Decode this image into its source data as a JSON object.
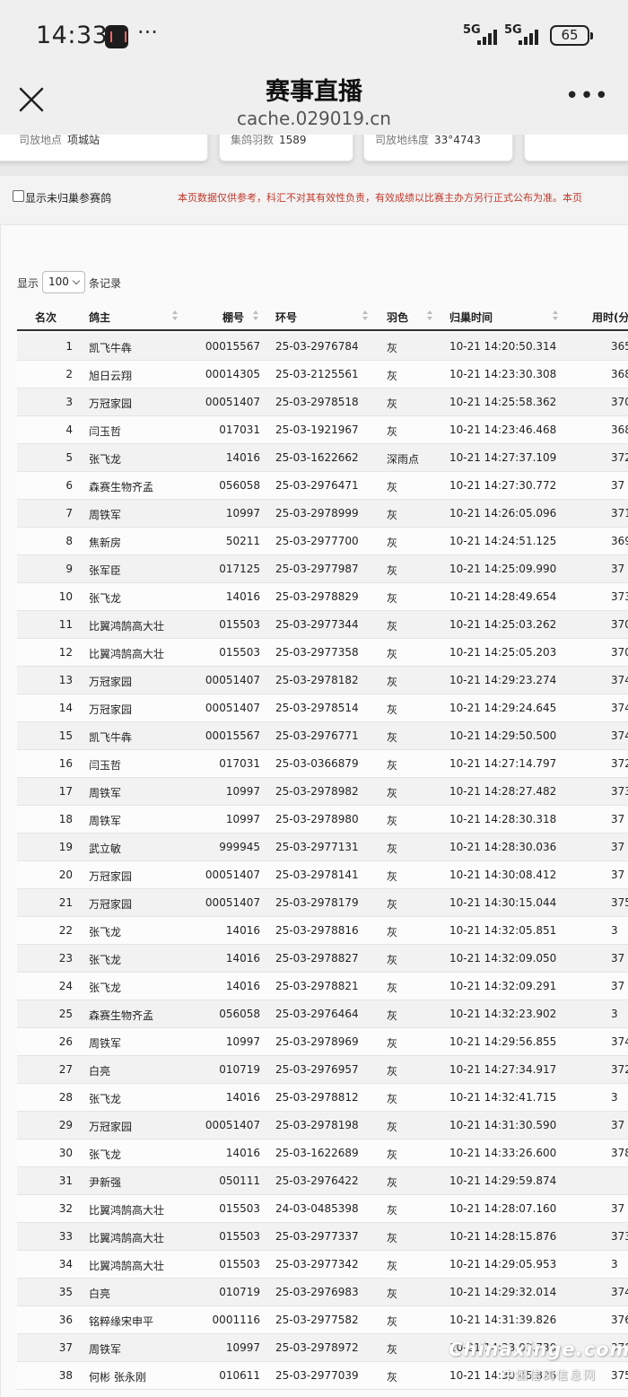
{
  "status_bar": {
    "time": "14:33",
    "network_1": "5G",
    "network_2": "5G",
    "battery": "65"
  },
  "nav": {
    "title": "赛事直播",
    "url": "cache.029019.cn"
  },
  "info_cards": [
    {
      "label": "司放地点",
      "value": "项城站"
    },
    {
      "label": "集鸽羽数",
      "value": "1589"
    },
    {
      "label": "司放地纬度",
      "value": "33°4743"
    },
    {
      "label": "",
      "value": ""
    }
  ],
  "filters": {
    "show_unreturned_label": "显示未归巢参赛鸽",
    "disclaimer": "本页数据仅供参考，科汇不对其有效性负责，有效成绩以比赛主办方另行正式公布为准。本页"
  },
  "length_control": {
    "prefix": "显示",
    "selected": "100",
    "suffix": "条记录"
  },
  "table": {
    "headers": {
      "rank": "名次",
      "owner": "鸽主",
      "loft": "棚号",
      "ring": "环号",
      "color": "羽色",
      "return_time": "归巢时间",
      "time_used": "用时(分"
    },
    "rows": [
      {
        "rank": "1",
        "owner": "凯飞牛犇",
        "loft": "00015567",
        "ring": "25-03-2976784",
        "color": "灰",
        "time": "10-21 14:20:50.314",
        "used": "365"
      },
      {
        "rank": "2",
        "owner": "旭日云翔",
        "loft": "00014305",
        "ring": "25-03-2125561",
        "color": "灰",
        "time": "10-21 14:23:30.308",
        "used": "368"
      },
      {
        "rank": "3",
        "owner": "万冠家园",
        "loft": "00051407",
        "ring": "25-03-2978518",
        "color": "灰",
        "time": "10-21 14:25:58.362",
        "used": "370"
      },
      {
        "rank": "4",
        "owner": "闫玉哲",
        "loft": "017031",
        "ring": "25-03-1921967",
        "color": "灰",
        "time": "10-21 14:23:46.468",
        "used": "368"
      },
      {
        "rank": "5",
        "owner": "张飞龙",
        "loft": "14016",
        "ring": "25-03-1622662",
        "color": "深雨点",
        "time": "10-21 14:27:37.109",
        "used": "372"
      },
      {
        "rank": "6",
        "owner": "森赛生物齐孟",
        "loft": "056058",
        "ring": "25-03-2976471",
        "color": "灰",
        "time": "10-21 14:27:30.772",
        "used": "37"
      },
      {
        "rank": "7",
        "owner": "周铁军",
        "loft": "10997",
        "ring": "25-03-2978999",
        "color": "灰",
        "time": "10-21 14:26:05.096",
        "used": "371"
      },
      {
        "rank": "8",
        "owner": "焦新房",
        "loft": "50211",
        "ring": "25-03-2977700",
        "color": "灰",
        "time": "10-21 14:24:51.125",
        "used": "369"
      },
      {
        "rank": "9",
        "owner": "张军臣",
        "loft": "017125",
        "ring": "25-03-2977987",
        "color": "灰",
        "time": "10-21 14:25:09.990",
        "used": "37"
      },
      {
        "rank": "10",
        "owner": "张飞龙",
        "loft": "14016",
        "ring": "25-03-2978829",
        "color": "灰",
        "time": "10-21 14:28:49.654",
        "used": "373"
      },
      {
        "rank": "11",
        "owner": "比翼鸿鹄高大壮",
        "loft": "015503",
        "ring": "25-03-2977344",
        "color": "灰",
        "time": "10-21 14:25:03.262",
        "used": "370"
      },
      {
        "rank": "12",
        "owner": "比翼鸿鹄高大壮",
        "loft": "015503",
        "ring": "25-03-2977358",
        "color": "灰",
        "time": "10-21 14:25:05.203",
        "used": "370"
      },
      {
        "rank": "13",
        "owner": "万冠家园",
        "loft": "00051407",
        "ring": "25-03-2978182",
        "color": "灰",
        "time": "10-21 14:29:23.274",
        "used": "374"
      },
      {
        "rank": "14",
        "owner": "万冠家园",
        "loft": "00051407",
        "ring": "25-03-2978514",
        "color": "灰",
        "time": "10-21 14:29:24.645",
        "used": "374"
      },
      {
        "rank": "15",
        "owner": "凯飞牛犇",
        "loft": "00015567",
        "ring": "25-03-2976771",
        "color": "灰",
        "time": "10-21 14:29:50.500",
        "used": "374"
      },
      {
        "rank": "16",
        "owner": "闫玉哲",
        "loft": "017031",
        "ring": "25-03-0366879",
        "color": "灰",
        "time": "10-21 14:27:14.797",
        "used": "372"
      },
      {
        "rank": "17",
        "owner": "周铁军",
        "loft": "10997",
        "ring": "25-03-2978982",
        "color": "灰",
        "time": "10-21 14:28:27.482",
        "used": "373"
      },
      {
        "rank": "18",
        "owner": "周铁军",
        "loft": "10997",
        "ring": "25-03-2978980",
        "color": "灰",
        "time": "10-21 14:28:30.318",
        "used": "37"
      },
      {
        "rank": "19",
        "owner": "武立敏",
        "loft": "999945",
        "ring": "25-03-2977131",
        "color": "灰",
        "time": "10-21 14:28:30.036",
        "used": "37"
      },
      {
        "rank": "20",
        "owner": "万冠家园",
        "loft": "00051407",
        "ring": "25-03-2978141",
        "color": "灰",
        "time": "10-21 14:30:08.412",
        "used": "37"
      },
      {
        "rank": "21",
        "owner": "万冠家园",
        "loft": "00051407",
        "ring": "25-03-2978179",
        "color": "灰",
        "time": "10-21 14:30:15.044",
        "used": "375"
      },
      {
        "rank": "22",
        "owner": "张飞龙",
        "loft": "14016",
        "ring": "25-03-2978816",
        "color": "灰",
        "time": "10-21 14:32:05.851",
        "used": "3"
      },
      {
        "rank": "23",
        "owner": "张飞龙",
        "loft": "14016",
        "ring": "25-03-2978827",
        "color": "灰",
        "time": "10-21 14:32:09.050",
        "used": "37"
      },
      {
        "rank": "24",
        "owner": "张飞龙",
        "loft": "14016",
        "ring": "25-03-2978821",
        "color": "灰",
        "time": "10-21 14:32:09.291",
        "used": "37"
      },
      {
        "rank": "25",
        "owner": "森赛生物齐孟",
        "loft": "056058",
        "ring": "25-03-2976464",
        "color": "灰",
        "time": "10-21 14:32:23.902",
        "used": "3"
      },
      {
        "rank": "26",
        "owner": "周铁军",
        "loft": "10997",
        "ring": "25-03-2978969",
        "color": "灰",
        "time": "10-21 14:29:56.855",
        "used": "374"
      },
      {
        "rank": "27",
        "owner": "白亮",
        "loft": "010719",
        "ring": "25-03-2976957",
        "color": "灰",
        "time": "10-21 14:27:34.917",
        "used": "372"
      },
      {
        "rank": "28",
        "owner": "张飞龙",
        "loft": "14016",
        "ring": "25-03-2978812",
        "color": "灰",
        "time": "10-21 14:32:41.715",
        "used": "3"
      },
      {
        "rank": "29",
        "owner": "万冠家园",
        "loft": "00051407",
        "ring": "25-03-2978198",
        "color": "灰",
        "time": "10-21 14:31:30.590",
        "used": "37"
      },
      {
        "rank": "30",
        "owner": "张飞龙",
        "loft": "14016",
        "ring": "25-03-1622689",
        "color": "灰",
        "time": "10-21 14:33:26.600",
        "used": "378"
      },
      {
        "rank": "31",
        "owner": "尹新强",
        "loft": "050111",
        "ring": "25-03-2976422",
        "color": "灰",
        "time": "10-21 14:29:59.874",
        "used": ""
      },
      {
        "rank": "32",
        "owner": "比翼鸿鹄高大壮",
        "loft": "015503",
        "ring": "24-03-0485398",
        "color": "灰",
        "time": "10-21 14:28:07.160",
        "used": "37"
      },
      {
        "rank": "33",
        "owner": "比翼鸿鹄高大壮",
        "loft": "015503",
        "ring": "25-03-2977337",
        "color": "灰",
        "time": "10-21 14:28:15.876",
        "used": "373"
      },
      {
        "rank": "34",
        "owner": "比翼鸿鹄高大壮",
        "loft": "015503",
        "ring": "25-03-2977342",
        "color": "灰",
        "time": "10-21 14:29:05.953",
        "used": "3"
      },
      {
        "rank": "35",
        "owner": "白亮",
        "loft": "010719",
        "ring": "25-03-2976983",
        "color": "灰",
        "time": "10-21 14:29:32.014",
        "used": "374"
      },
      {
        "rank": "36",
        "owner": "铭粹缘宋申平",
        "loft": "0001116",
        "ring": "25-03-2977582",
        "color": "灰",
        "time": "10-21 14:31:39.826",
        "used": "376"
      },
      {
        "rank": "37",
        "owner": "周铁军",
        "loft": "10997",
        "ring": "25-03-2978972",
        "color": "灰",
        "time": "10-21 14:33:03.730",
        "used": "378"
      },
      {
        "rank": "38",
        "owner": "何彬 张永刚",
        "loft": "010611",
        "ring": "25-03-2977039",
        "color": "灰",
        "time": "10-21 14:30:45.826",
        "used": "375"
      }
    ]
  },
  "watermark": {
    "text": "Chinaxinge.com",
    "sub": "中国信鸽信息网"
  }
}
